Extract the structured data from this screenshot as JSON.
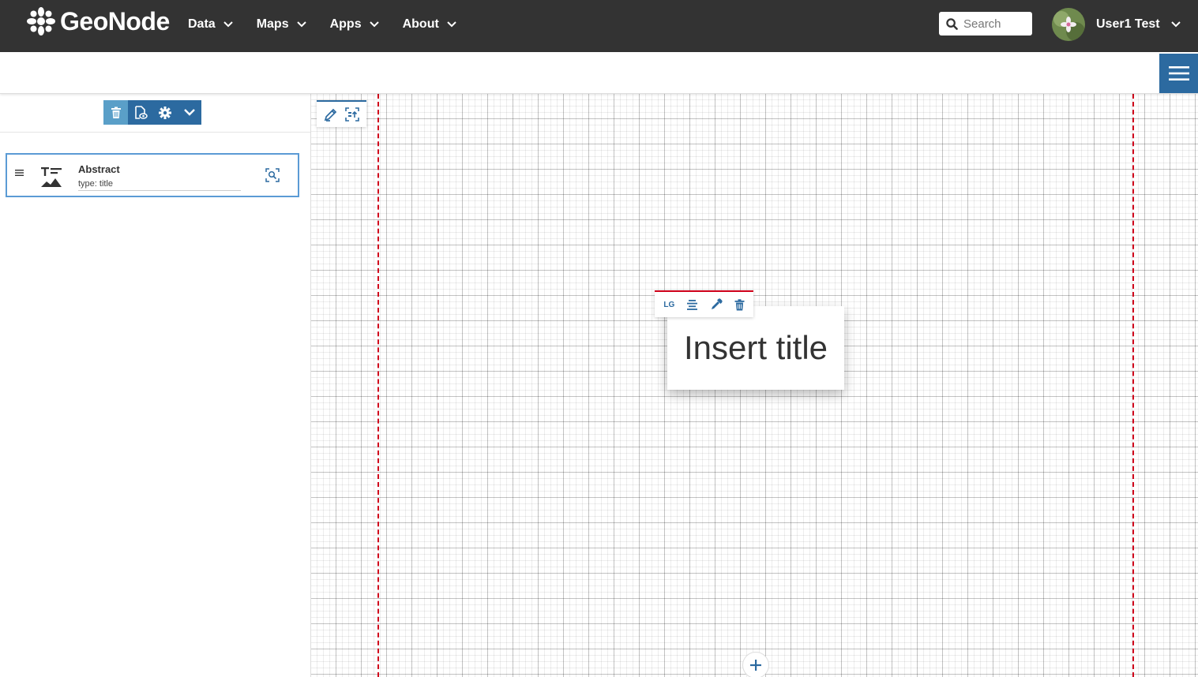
{
  "app": {
    "brand": "GeoNode",
    "colors": {
      "navbar": "#333333",
      "accent": "#2c6aa0",
      "guide": "#d0021b"
    }
  },
  "nav": {
    "items": [
      {
        "label": "Data"
      },
      {
        "label": "Maps"
      },
      {
        "label": "Apps"
      },
      {
        "label": "About"
      }
    ],
    "search": {
      "placeholder": "Search",
      "value": ""
    },
    "user": {
      "name": "User1 Test"
    }
  },
  "sidebar": {
    "toolbar_icons": [
      "trash-icon",
      "preview-icon",
      "gear-icon",
      "chevron-down-icon"
    ],
    "sections": [
      {
        "title": "Abstract",
        "type": "type: title",
        "thumbnail": "title-section-icon"
      }
    ]
  },
  "canvas": {
    "tools": [
      "pencil-icon",
      "fit-screen-icon"
    ],
    "element_toolbar": {
      "size_label": "LG",
      "icons": [
        "align-center-icon",
        "eyedropper-icon",
        "trash-icon"
      ]
    },
    "title_placeholder": "Insert title",
    "add_icon": "plus-icon"
  }
}
